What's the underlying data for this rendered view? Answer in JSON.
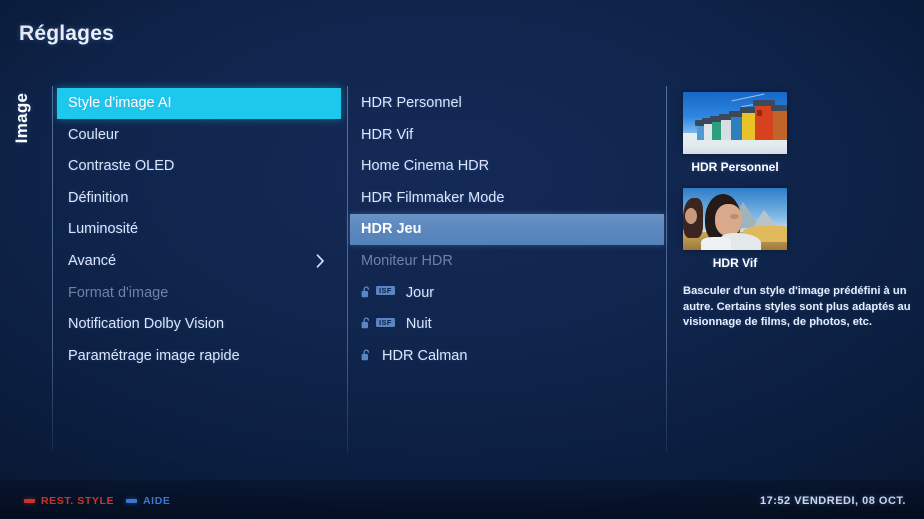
{
  "header": {
    "title": "Réglages"
  },
  "category": {
    "label": "Image"
  },
  "left_menu": {
    "items": [
      {
        "label": "Style d'image AI",
        "state": "selected",
        "chevron": false
      },
      {
        "label": "Couleur",
        "state": "normal",
        "chevron": false
      },
      {
        "label": "Contraste OLED",
        "state": "normal",
        "chevron": false
      },
      {
        "label": "Définition",
        "state": "normal",
        "chevron": false
      },
      {
        "label": "Luminosité",
        "state": "normal",
        "chevron": false
      },
      {
        "label": "Avancé",
        "state": "normal",
        "chevron": true
      },
      {
        "label": "Format d'image",
        "state": "disabled",
        "chevron": false
      },
      {
        "label": "Notification Dolby Vision",
        "state": "normal",
        "chevron": false
      },
      {
        "label": "Paramétrage image rapide",
        "state": "normal",
        "chevron": false
      }
    ]
  },
  "mid_menu": {
    "items": [
      {
        "label": "HDR Personnel",
        "state": "normal",
        "lock": false,
        "isf": false
      },
      {
        "label": "HDR Vif",
        "state": "normal",
        "lock": false,
        "isf": false
      },
      {
        "label": "Home Cinema HDR",
        "state": "normal",
        "lock": false,
        "isf": false
      },
      {
        "label": "HDR Filmmaker Mode",
        "state": "normal",
        "lock": false,
        "isf": false
      },
      {
        "label": "HDR Jeu",
        "state": "highlighted",
        "lock": false,
        "isf": false
      },
      {
        "label": "Moniteur HDR",
        "state": "disabled",
        "lock": false,
        "isf": false
      },
      {
        "label": "Jour",
        "state": "normal",
        "lock": true,
        "isf": true,
        "isf_text": "ISF"
      },
      {
        "label": "Nuit",
        "state": "normal",
        "lock": true,
        "isf": true,
        "isf_text": "ISF"
      },
      {
        "label": "HDR Calman",
        "state": "normal",
        "lock": true,
        "isf": false
      }
    ]
  },
  "preview": {
    "thumbnails": [
      {
        "caption": "HDR Personnel",
        "image": "beach-huts-photo"
      },
      {
        "caption": "HDR Vif",
        "image": "girl-portrait-photo"
      }
    ],
    "description": "Basculer d'un style d'image prédéfini à un autre. Certains styles sont plus adaptés au visionnage de films, de photos, etc."
  },
  "footer": {
    "hints": [
      {
        "label": "REST. STYLE",
        "color": "#e2392f"
      },
      {
        "label": "AIDE",
        "color": "#3f7fe0"
      }
    ],
    "clock": "17:52 VENDREDI, 08 OCT."
  },
  "colors": {
    "background": "#0b1f42",
    "selected_cyan": "#1ec8ec",
    "highlight_steel": "#5b87bd",
    "text": "#dbe6fb",
    "disabled_text": "#6d82a8"
  }
}
